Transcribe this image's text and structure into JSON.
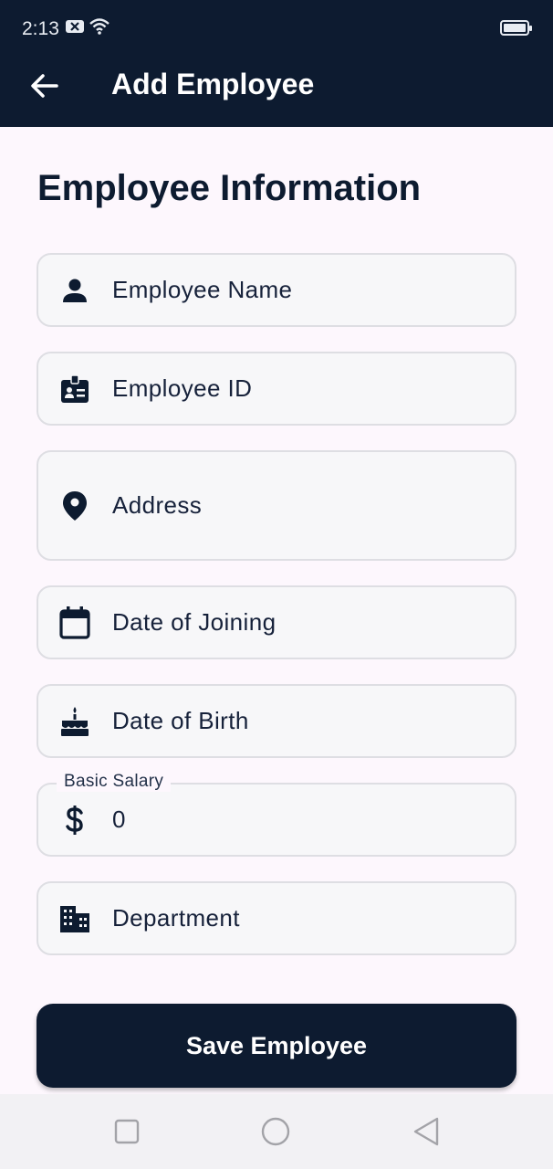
{
  "status": {
    "time": "2:13"
  },
  "app_bar": {
    "title": "Add Employee"
  },
  "section": {
    "title": "Employee Information"
  },
  "fields": [
    {
      "label": "Employee Name",
      "icon": "person-icon"
    },
    {
      "label": "Employee ID",
      "icon": "badge-icon"
    },
    {
      "label": "Address",
      "icon": "location-pin-icon"
    },
    {
      "label": "Date of Joining",
      "icon": "calendar-icon"
    },
    {
      "label": "Date of Birth",
      "icon": "cake-icon"
    },
    {
      "label": "Basic Salary",
      "icon": "dollar-icon",
      "value": "0"
    },
    {
      "label": "Department",
      "icon": "building-icon"
    }
  ],
  "save_button": {
    "label": "Save Employee"
  },
  "colors": {
    "primary": "#0d1b30",
    "background": "#fdf7fd",
    "field_bg": "#f7f7f9",
    "field_border": "#dedee3"
  }
}
